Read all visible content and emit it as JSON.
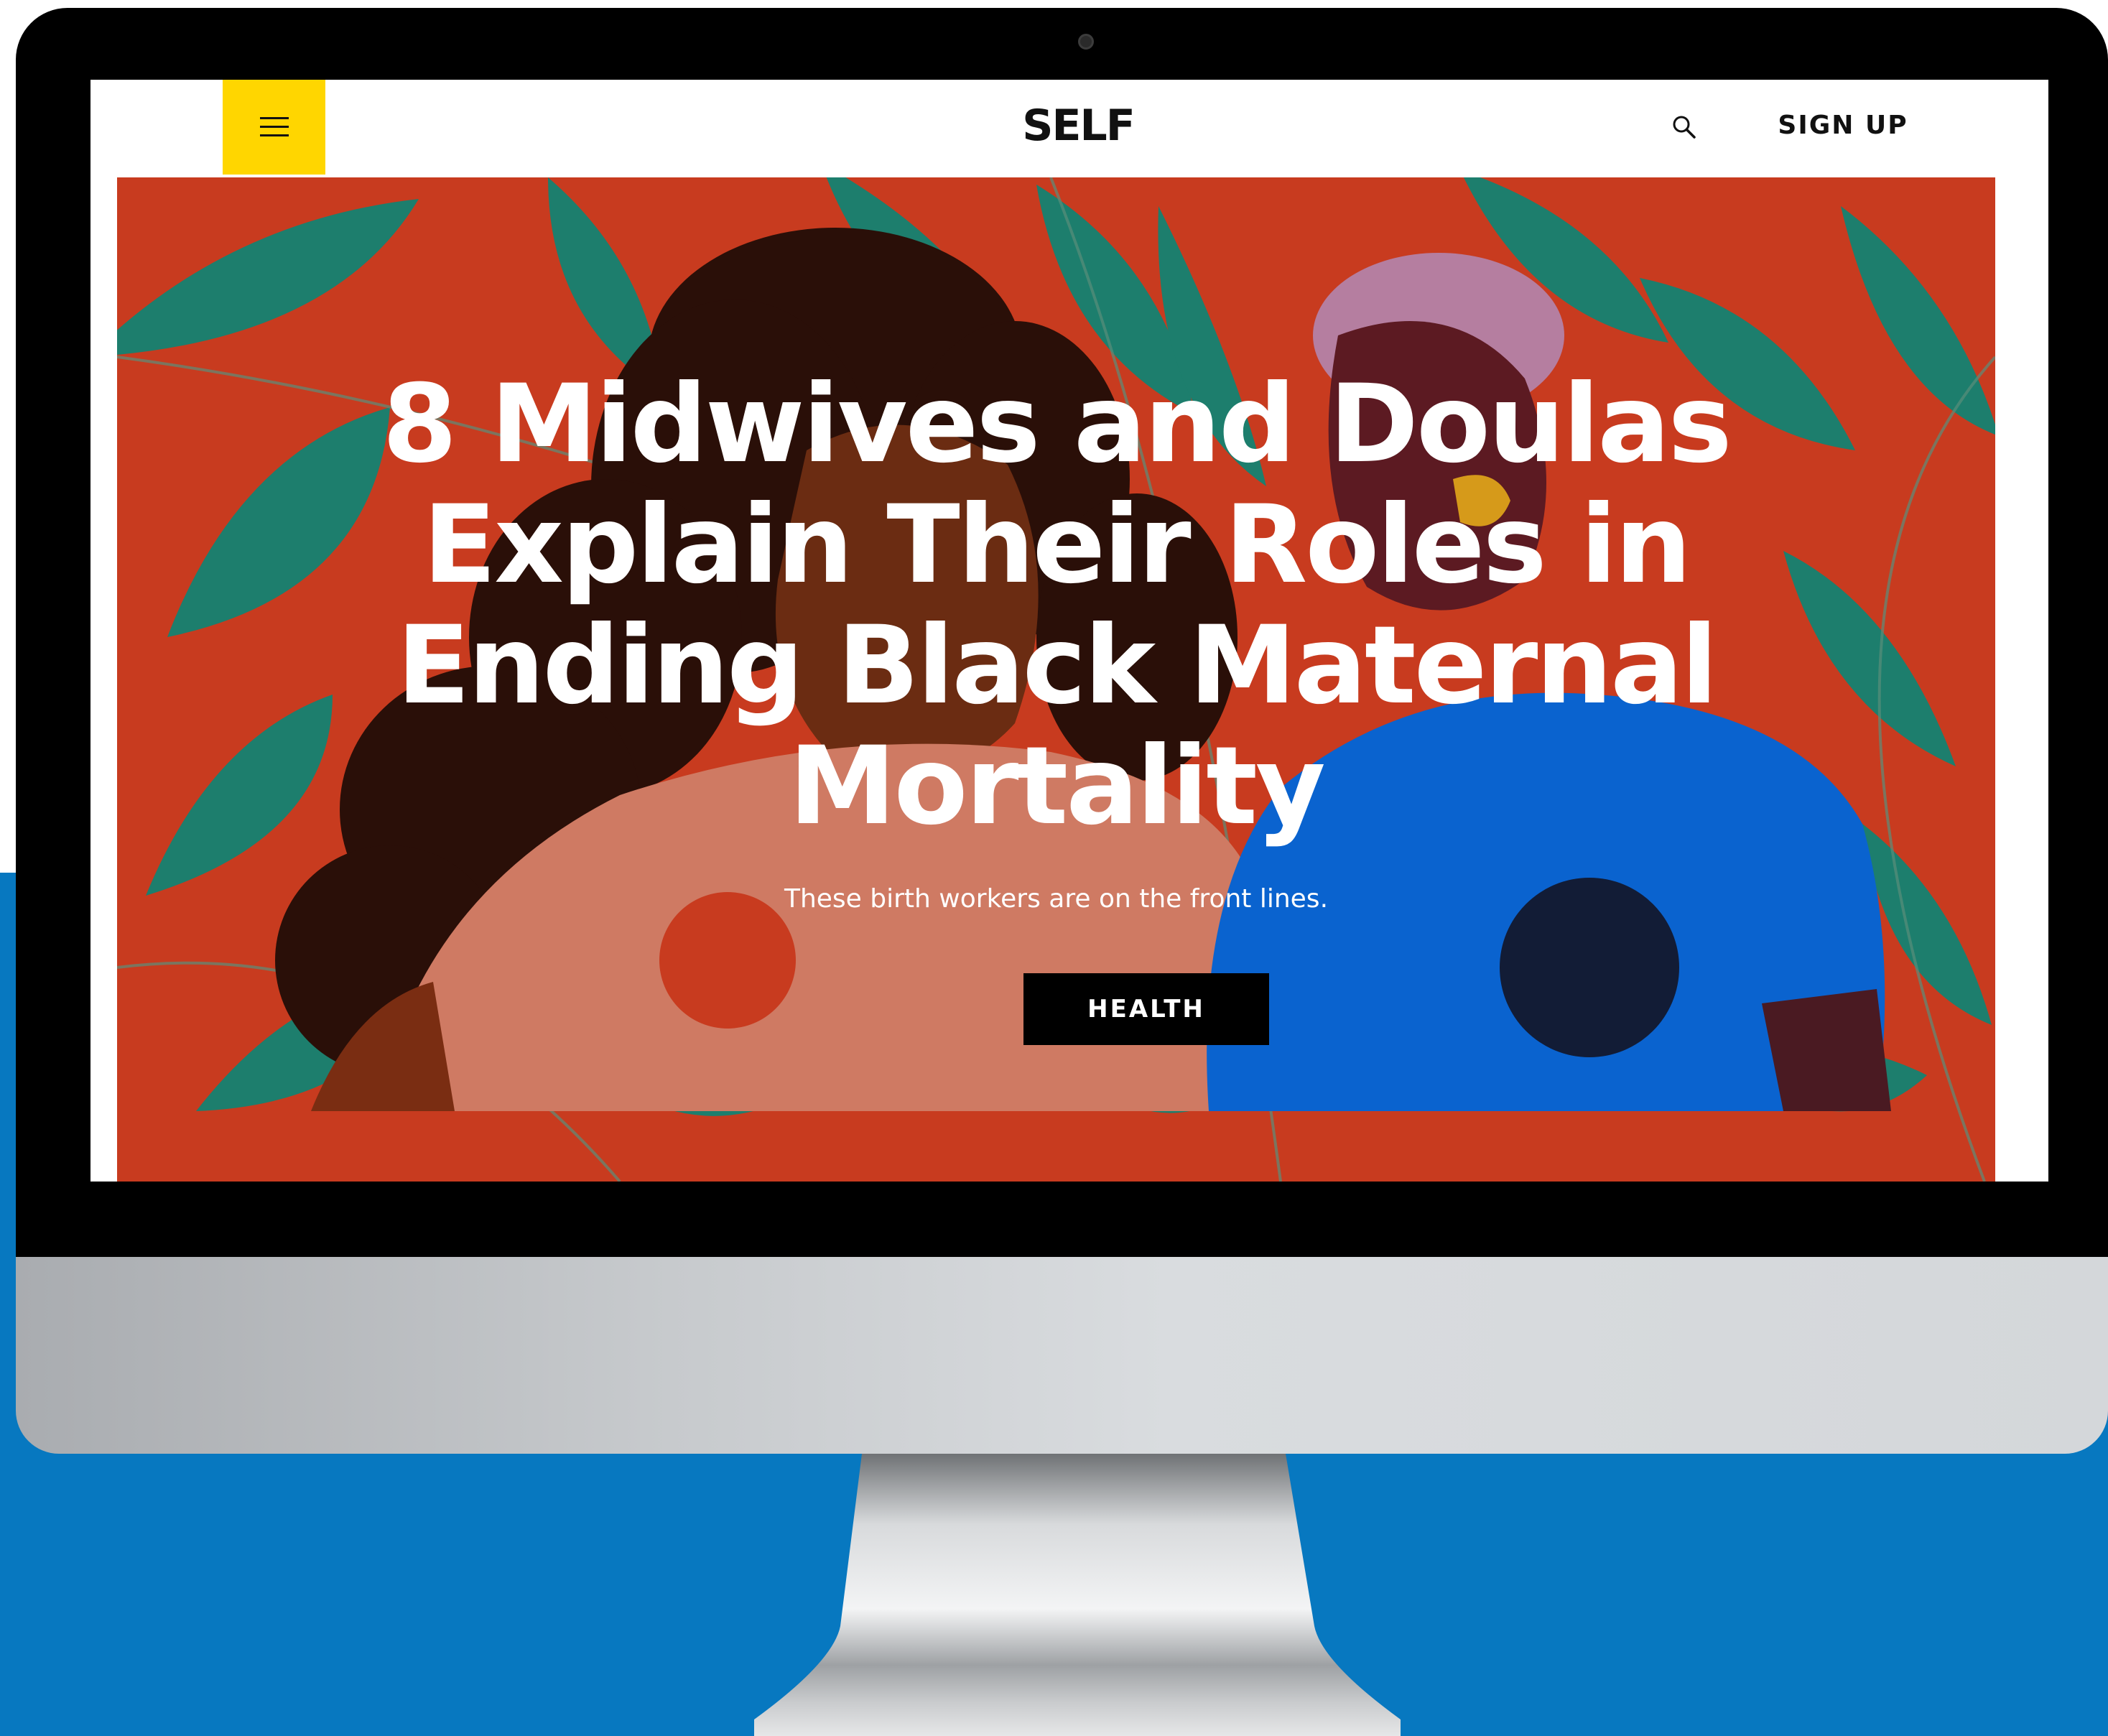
{
  "header": {
    "menu_icon": "hamburger-menu-icon",
    "logo": "SELF",
    "search_icon": "search-icon",
    "signup_label": "SIGN UP"
  },
  "hero": {
    "headline": "8 Midwives and Doulas Explain Their Roles in Ending Black Maternal Mortality",
    "dek": "These birth workers are on the front lines.",
    "tag_label": "HEALTH"
  },
  "colors": {
    "menu_button": "#ffd600",
    "hero_background": "#c83b1f",
    "leaf_green": "#1d7e6d",
    "shirt_blue": "#0a63cf",
    "shirt_peach": "#cf7a63",
    "tag_background": "#000000",
    "page_background": "#0778c0"
  }
}
